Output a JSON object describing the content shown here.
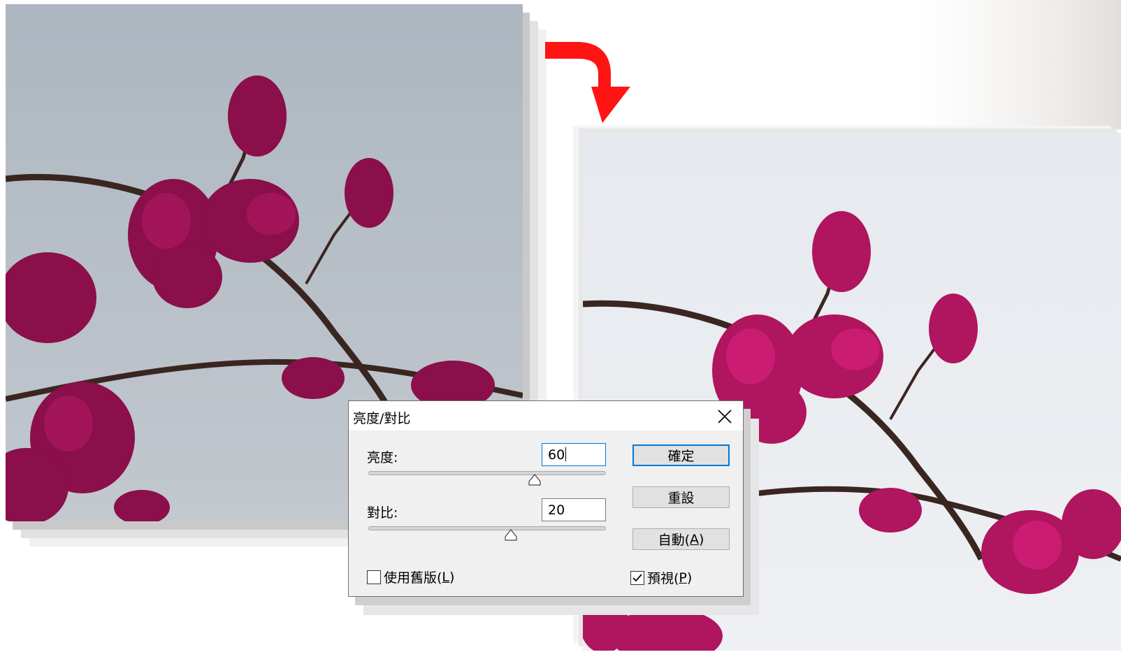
{
  "dialog": {
    "title": "亮度/對比",
    "brightness_label": "亮度:",
    "brightness_value": "60",
    "contrast_label": "對比:",
    "contrast_value": "20",
    "ok_label": "確定",
    "reset_label": "重設",
    "auto_label": "自動(",
    "auto_key": "A",
    "legacy_label": "使用舊版(",
    "legacy_key": "L",
    "legacy_checked": false,
    "preview_label": "預視(",
    "preview_key": "P",
    "preview_checked": true,
    "close_paren": ")"
  },
  "colors": {
    "arrow": "#ff1414",
    "focus_blue": "#0078d7",
    "petal": "#b0155f",
    "sky_before": "#b9c1ca",
    "sky_after": "#e9ecf1"
  },
  "icons": [
    "close-icon",
    "checkmark-icon",
    "red-curved-arrow-icon",
    "slider-thumb-icon"
  ]
}
